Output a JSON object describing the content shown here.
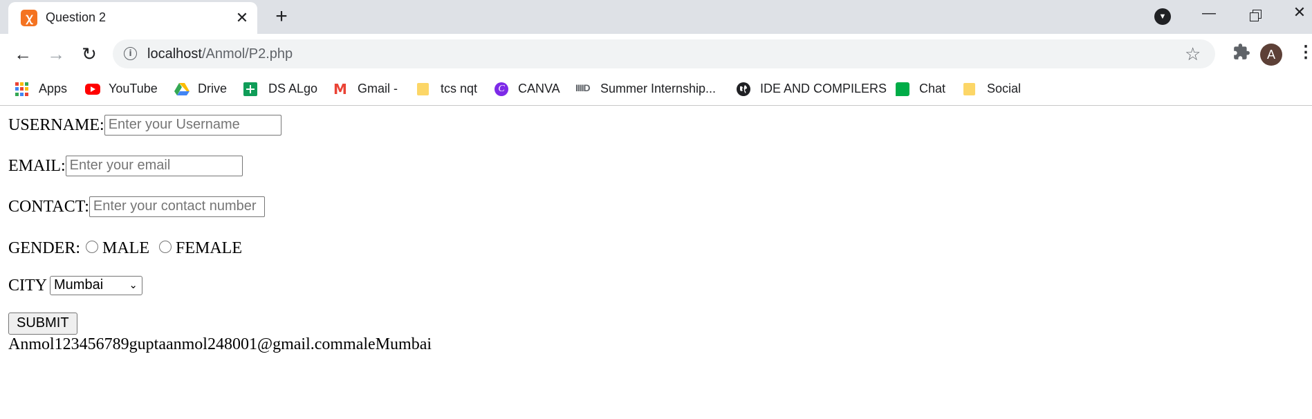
{
  "browser": {
    "tab": {
      "title": "Question 2",
      "close": "✕"
    },
    "new_tab": "+",
    "address": {
      "host": "localhost",
      "path": "/Anmol/P2.php"
    },
    "profile_initial": "A",
    "bookmarks": [
      {
        "label": "Apps",
        "icon": "apps-grid-icon"
      },
      {
        "label": "YouTube",
        "icon": "youtube-icon"
      },
      {
        "label": "Drive",
        "icon": "google-drive-icon"
      },
      {
        "label": "DS ALgo",
        "icon": "google-sheets-icon"
      },
      {
        "label": "Gmail -",
        "icon": "gmail-icon"
      },
      {
        "label": "tcs nqt",
        "icon": "folder-icon"
      },
      {
        "label": "CANVA",
        "icon": "canva-icon"
      },
      {
        "label": "Summer Internship...",
        "icon": "internship-icon"
      },
      {
        "label": "IDE AND COMPILERS",
        "icon": "globe-icon"
      },
      {
        "label": "Chat",
        "icon": "google-chat-icon"
      },
      {
        "label": "Social",
        "icon": "folder-icon"
      }
    ]
  },
  "form": {
    "username_label": "USERNAME:",
    "username_placeholder": "Enter your Username",
    "email_label": "EMAIL:",
    "email_placeholder": "Enter your email",
    "contact_label": "CONTACT:",
    "contact_placeholder": "Enter your contact number",
    "gender_label": "GENDER:",
    "gender_male": "MALE",
    "gender_female": "FEMALE",
    "city_label": "CITY",
    "city_selected": "Mumbai",
    "submit_label": "SUBMIT"
  },
  "output_text": "Anmol123456789guptaanmol248001@gmail.commaleMumbai"
}
